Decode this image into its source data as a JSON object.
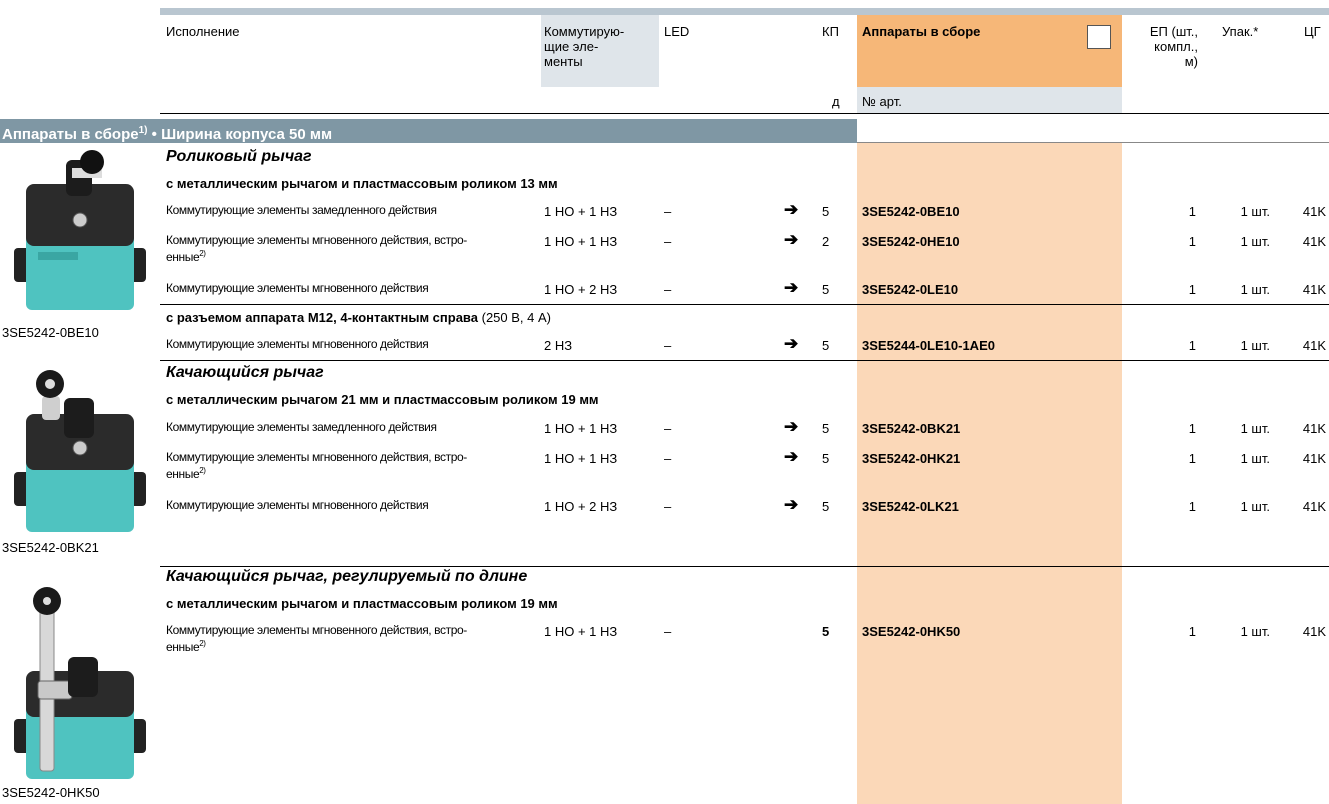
{
  "header": {
    "col_execution": "Исполнение",
    "col_switching_1": "Коммутирую-",
    "col_switching_2": "щие эле-",
    "col_switching_3": "менты",
    "col_led": "LED",
    "col_kp": "КП",
    "col_kp_sub": "д",
    "col_assembled": "Аппараты в сборе",
    "col_article": "№ арт.",
    "col_ep_1": "ЕП (шт.,",
    "col_ep_2": "компл.,",
    "col_ep_3": "м)",
    "col_pack": "Упак.*",
    "col_cg": "ЦГ"
  },
  "section": {
    "title_main": "Аппараты в сборе",
    "title_sup": "1)",
    "title_rest": " • Ширина корпуса 50 мм"
  },
  "groups": [
    {
      "title": "Роликовый рычаг",
      "caption": "3SE5242-0BE10",
      "subgroups": [
        {
          "heading_bold": "с металлическим рычагом и пластмассовым роликом 13 мм",
          "heading_normal": "",
          "rows": [
            {
              "desc": "Коммутирующие элементы замедленного действия",
              "desc2": "",
              "sup": "",
              "contacts": "1 НО + 1 НЗ",
              "led": "–",
              "arrow": "➔",
              "kp": "5",
              "article": "3SE5242-0BE10",
              "ep": "1",
              "pack": "1 шт.",
              "cg": "41K"
            },
            {
              "desc": "Коммутирующие элементы мгновенного действия, встро-",
              "desc2": "енные",
              "sup": "2)",
              "contacts": "1 НО + 1 НЗ",
              "led": "–",
              "arrow": "➔",
              "kp": "2",
              "article": "3SE5242-0HE10",
              "ep": "1",
              "pack": "1 шт.",
              "cg": "41K"
            },
            {
              "desc": "Коммутирующие элементы мгновенного действия",
              "desc2": "",
              "sup": "",
              "contacts": "1 НО + 2 НЗ",
              "led": "–",
              "arrow": "➔",
              "kp": "5",
              "article": "3SE5242-0LE10",
              "ep": "1",
              "pack": "1 шт.",
              "cg": "41K"
            }
          ]
        },
        {
          "heading_bold": "с разъемом аппарата М12, 4-контактным справа",
          "heading_normal": " (250 В, 4 А)",
          "rows": [
            {
              "desc": "Коммутирующие элементы мгновенного действия",
              "desc2": "",
              "sup": "",
              "contacts": "2 НЗ",
              "led": "–",
              "arrow": "➔",
              "kp": "5",
              "article": "3SE5244-0LE10-1AE0",
              "ep": "1",
              "pack": "1 шт.",
              "cg": "41K"
            }
          ]
        }
      ]
    },
    {
      "title": "Качающийся рычаг",
      "caption": "3SE5242-0BK21",
      "subgroups": [
        {
          "heading_bold": "с металлическим рычагом 21 мм и пластмассовым роликом 19 мм",
          "heading_normal": "",
          "rows": [
            {
              "desc": "Коммутирующие элементы замедленного действия",
              "desc2": "",
              "sup": "",
              "contacts": "1 НО + 1 НЗ",
              "led": "–",
              "arrow": "➔",
              "kp": "5",
              "article": "3SE5242-0BK21",
              "ep": "1",
              "pack": "1 шт.",
              "cg": "41K"
            },
            {
              "desc": "Коммутирующие элементы мгновенного действия, встро-",
              "desc2": "енные",
              "sup": "2)",
              "contacts": "1 НО + 1 НЗ",
              "led": "–",
              "arrow": "➔",
              "kp": "5",
              "article": "3SE5242-0HK21",
              "ep": "1",
              "pack": "1 шт.",
              "cg": "41K"
            },
            {
              "desc": "Коммутирующие элементы мгновенного действия",
              "desc2": "",
              "sup": "",
              "contacts": "1 НО + 2 НЗ",
              "led": "–",
              "arrow": "➔",
              "kp": "5",
              "article": "3SE5242-0LK21",
              "ep": "1",
              "pack": "1 шт.",
              "cg": "41K"
            }
          ]
        }
      ]
    },
    {
      "title": "Качающийся рычаг, регулируемый по длине",
      "caption": "3SE5242-0HK50",
      "subgroups": [
        {
          "heading_bold": "с металлическим рычагом и пластмассовым роликом 19 мм",
          "heading_normal": "",
          "rows": [
            {
              "desc": "Коммутирующие элементы мгновенного действия, встро-",
              "desc2": "енные",
              "sup": "2)",
              "contacts": "1 НО + 1 НЗ",
              "led": "–",
              "arrow": "",
              "kp": "5",
              "article": "3SE5242-0HK50",
              "ep": "1",
              "pack": "1 шт.",
              "cg": "41K"
            }
          ]
        }
      ]
    }
  ],
  "colors": {
    "section_bg": "#7f97a4",
    "header_orange": "#f6b778",
    "article_col": "#fbd8b8",
    "header_grey": "#dfe5ea",
    "device_teal": "#4fc3c0"
  }
}
